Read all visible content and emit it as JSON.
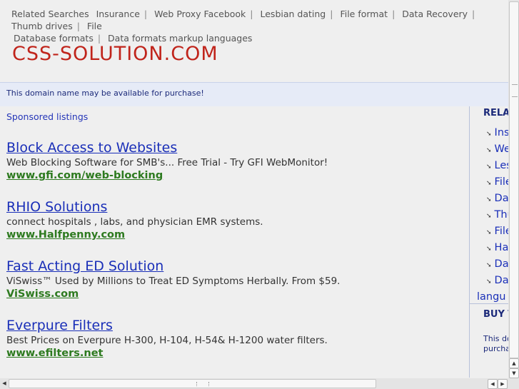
{
  "topnav": {
    "lead": "Related Searches",
    "links": [
      "Insurance",
      "Web Proxy Facebook",
      "Lesbian dating",
      "File format",
      "Data Recovery",
      "Thumb drives",
      "File",
      "Database formats",
      "Data formats markup languages"
    ]
  },
  "brand": {
    "title": "CSS-SOLUTION.COM",
    "color": "#c0241b"
  },
  "banner": {
    "text": "This domain name may be available for purchase!"
  },
  "main": {
    "sponsored_label": "Sponsored listings",
    "ads": [
      {
        "title": "Block Access to Websites",
        "desc": "Web Blocking Software for SMB's... Free Trial - Try GFI WebMonitor!",
        "url": "www.gfi.com/web-blocking"
      },
      {
        "title": "RHIO Solutions",
        "desc": "connect hospitals , labs, and physician EMR systems.",
        "url": "www.Halfpenny.com"
      },
      {
        "title": "Fast Acting ED Solution",
        "desc": "ViSwiss™ Used by Millions to Treat ED Symptoms Herbally. From $59.",
        "url": "ViSwiss.com"
      },
      {
        "title": "Everpure Filters",
        "desc": "Best Prices on Everpure H-300, H-104, H-54& H-1200 water filters.",
        "url": "www.efilters.net"
      }
    ]
  },
  "sidebar": {
    "heading": "RELA",
    "items": [
      "Ins",
      "We",
      "Les",
      "File",
      "Dat",
      "Thu",
      "File",
      "Har",
      "Dat",
      "Dat"
    ],
    "item_wrap": "langu",
    "buy_heading": "BUY T",
    "buy_text_1": "This do",
    "buy_text_2": "purcha"
  },
  "colors": {
    "link": "#1a2fb8",
    "url_green": "#2d7a1f",
    "banner_bg": "#e6ebf7"
  },
  "icons": {
    "scroll_up": "triangle-up-icon",
    "scroll_down": "triangle-down-icon",
    "scroll_left": "triangle-left-icon",
    "scroll_right": "triangle-right-icon"
  }
}
